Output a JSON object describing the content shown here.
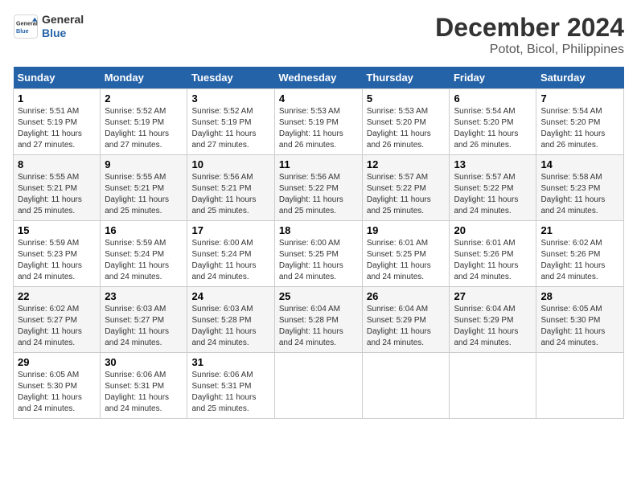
{
  "logo": {
    "line1": "General",
    "line2": "Blue"
  },
  "title": "December 2024",
  "location": "Potot, Bicol, Philippines",
  "days_of_week": [
    "Sunday",
    "Monday",
    "Tuesday",
    "Wednesday",
    "Thursday",
    "Friday",
    "Saturday"
  ],
  "weeks": [
    [
      {
        "day": "1",
        "detail": "Sunrise: 5:51 AM\nSunset: 5:19 PM\nDaylight: 11 hours\nand 27 minutes."
      },
      {
        "day": "2",
        "detail": "Sunrise: 5:52 AM\nSunset: 5:19 PM\nDaylight: 11 hours\nand 27 minutes."
      },
      {
        "day": "3",
        "detail": "Sunrise: 5:52 AM\nSunset: 5:19 PM\nDaylight: 11 hours\nand 27 minutes."
      },
      {
        "day": "4",
        "detail": "Sunrise: 5:53 AM\nSunset: 5:19 PM\nDaylight: 11 hours\nand 26 minutes."
      },
      {
        "day": "5",
        "detail": "Sunrise: 5:53 AM\nSunset: 5:20 PM\nDaylight: 11 hours\nand 26 minutes."
      },
      {
        "day": "6",
        "detail": "Sunrise: 5:54 AM\nSunset: 5:20 PM\nDaylight: 11 hours\nand 26 minutes."
      },
      {
        "day": "7",
        "detail": "Sunrise: 5:54 AM\nSunset: 5:20 PM\nDaylight: 11 hours\nand 26 minutes."
      }
    ],
    [
      {
        "day": "8",
        "detail": "Sunrise: 5:55 AM\nSunset: 5:21 PM\nDaylight: 11 hours\nand 25 minutes."
      },
      {
        "day": "9",
        "detail": "Sunrise: 5:55 AM\nSunset: 5:21 PM\nDaylight: 11 hours\nand 25 minutes."
      },
      {
        "day": "10",
        "detail": "Sunrise: 5:56 AM\nSunset: 5:21 PM\nDaylight: 11 hours\nand 25 minutes."
      },
      {
        "day": "11",
        "detail": "Sunrise: 5:56 AM\nSunset: 5:22 PM\nDaylight: 11 hours\nand 25 minutes."
      },
      {
        "day": "12",
        "detail": "Sunrise: 5:57 AM\nSunset: 5:22 PM\nDaylight: 11 hours\nand 25 minutes."
      },
      {
        "day": "13",
        "detail": "Sunrise: 5:57 AM\nSunset: 5:22 PM\nDaylight: 11 hours\nand 24 minutes."
      },
      {
        "day": "14",
        "detail": "Sunrise: 5:58 AM\nSunset: 5:23 PM\nDaylight: 11 hours\nand 24 minutes."
      }
    ],
    [
      {
        "day": "15",
        "detail": "Sunrise: 5:59 AM\nSunset: 5:23 PM\nDaylight: 11 hours\nand 24 minutes."
      },
      {
        "day": "16",
        "detail": "Sunrise: 5:59 AM\nSunset: 5:24 PM\nDaylight: 11 hours\nand 24 minutes."
      },
      {
        "day": "17",
        "detail": "Sunrise: 6:00 AM\nSunset: 5:24 PM\nDaylight: 11 hours\nand 24 minutes."
      },
      {
        "day": "18",
        "detail": "Sunrise: 6:00 AM\nSunset: 5:25 PM\nDaylight: 11 hours\nand 24 minutes."
      },
      {
        "day": "19",
        "detail": "Sunrise: 6:01 AM\nSunset: 5:25 PM\nDaylight: 11 hours\nand 24 minutes."
      },
      {
        "day": "20",
        "detail": "Sunrise: 6:01 AM\nSunset: 5:26 PM\nDaylight: 11 hours\nand 24 minutes."
      },
      {
        "day": "21",
        "detail": "Sunrise: 6:02 AM\nSunset: 5:26 PM\nDaylight: 11 hours\nand 24 minutes."
      }
    ],
    [
      {
        "day": "22",
        "detail": "Sunrise: 6:02 AM\nSunset: 5:27 PM\nDaylight: 11 hours\nand 24 minutes."
      },
      {
        "day": "23",
        "detail": "Sunrise: 6:03 AM\nSunset: 5:27 PM\nDaylight: 11 hours\nand 24 minutes."
      },
      {
        "day": "24",
        "detail": "Sunrise: 6:03 AM\nSunset: 5:28 PM\nDaylight: 11 hours\nand 24 minutes."
      },
      {
        "day": "25",
        "detail": "Sunrise: 6:04 AM\nSunset: 5:28 PM\nDaylight: 11 hours\nand 24 minutes."
      },
      {
        "day": "26",
        "detail": "Sunrise: 6:04 AM\nSunset: 5:29 PM\nDaylight: 11 hours\nand 24 minutes."
      },
      {
        "day": "27",
        "detail": "Sunrise: 6:04 AM\nSunset: 5:29 PM\nDaylight: 11 hours\nand 24 minutes."
      },
      {
        "day": "28",
        "detail": "Sunrise: 6:05 AM\nSunset: 5:30 PM\nDaylight: 11 hours\nand 24 minutes."
      }
    ],
    [
      {
        "day": "29",
        "detail": "Sunrise: 6:05 AM\nSunset: 5:30 PM\nDaylight: 11 hours\nand 24 minutes."
      },
      {
        "day": "30",
        "detail": "Sunrise: 6:06 AM\nSunset: 5:31 PM\nDaylight: 11 hours\nand 24 minutes."
      },
      {
        "day": "31",
        "detail": "Sunrise: 6:06 AM\nSunset: 5:31 PM\nDaylight: 11 hours\nand 25 minutes."
      },
      null,
      null,
      null,
      null
    ]
  ]
}
